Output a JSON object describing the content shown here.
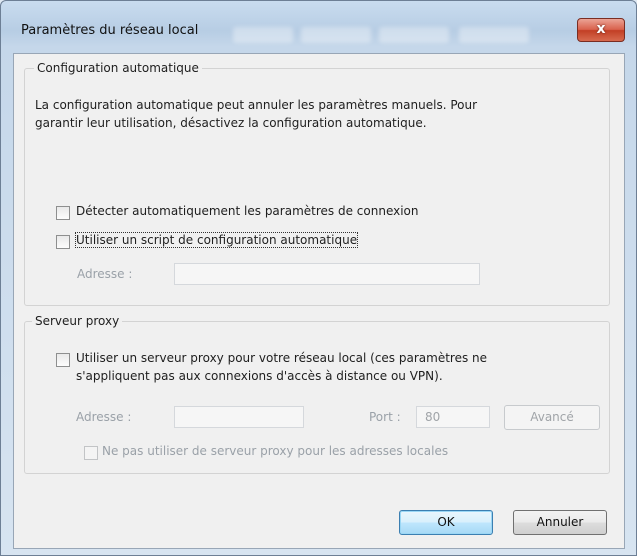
{
  "window": {
    "title": "Paramètres du réseau local",
    "close_label": "x"
  },
  "auto_config": {
    "legend": "Configuration automatique",
    "description_line1": "La configuration automatique peut annuler les paramètres manuels. Pour",
    "description_line2": "garantir leur utilisation, désactivez la configuration automatique.",
    "detect_label": "Détecter automatiquement les paramètres de connexion",
    "detect_checked": false,
    "script_label": "Utiliser un script de configuration automatique",
    "script_checked": false,
    "address_label": "Adresse :",
    "address_value": ""
  },
  "proxy": {
    "legend": "Serveur proxy",
    "use_proxy_label_line1": "Utiliser un serveur proxy pour votre réseau local (ces paramètres ne",
    "use_proxy_label_line2": "s'appliquent pas aux connexions d'accès à distance ou VPN).",
    "use_proxy_checked": false,
    "address_label": "Adresse :",
    "address_value": "",
    "port_label": "Port :",
    "port_value": "80",
    "advanced_label": "Avancé",
    "bypass_label": "Ne pas utiliser de serveur proxy pour les adresses locales",
    "bypass_checked": false
  },
  "buttons": {
    "ok": "OK",
    "cancel": "Annuler"
  }
}
